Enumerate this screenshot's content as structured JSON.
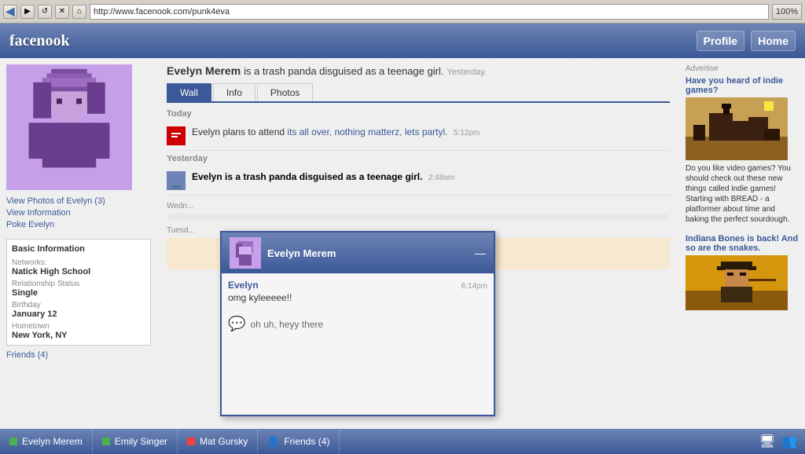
{
  "browser": {
    "back_icon": "◀",
    "forward_icon": "▶",
    "refresh_icon": "↺",
    "stop_icon": "✕",
    "home_icon": "⌂",
    "url": "http://www.facenook.com/punk4eva",
    "zoom": "100%"
  },
  "header": {
    "logo": "facenook",
    "nav": [
      "Profile",
      "Home"
    ]
  },
  "profile": {
    "name": "Evelyn Merem",
    "status": "is a trash panda disguised as a teenage girl.",
    "time": "Yesterday.",
    "tabs": [
      "Wall",
      "Info",
      "Photos"
    ],
    "active_tab": "Wall"
  },
  "sidebar": {
    "links": [
      "View Photos of Evelyn (3)",
      "View Information",
      "Poke Evelyn"
    ],
    "basic_info_title": "Basic Information",
    "networks_label": "Networks:",
    "networks_value": "Natick High School",
    "relationship_label": "Relationship Status",
    "relationship_value": "Single",
    "birthday_label": "Birthday",
    "birthday_value": "January 12",
    "hometown_label": "Hometown",
    "hometown_value": "New York, NY",
    "friends_label": "Friends (4)"
  },
  "wall": {
    "sections": [
      {
        "label": "Today",
        "posts": [
          {
            "icon": "📅",
            "text_start": "Evelyn plans to attend ",
            "text_link": "its all over, nothing matterz, lets partyl.",
            "time": "5:12pm"
          }
        ]
      },
      {
        "label": "Yesterday",
        "posts": [
          {
            "icon": "👤",
            "text_bold": "Evelyn is a trash panda disguised as a teenage girl.",
            "time": "2:48am"
          }
        ]
      }
    ]
  },
  "chat": {
    "name": "Evelyn Merem",
    "close_icon": "—",
    "message": {
      "sender": "Evelyn",
      "time": "6:14pm",
      "text": "omg kyleeeee!!"
    },
    "response_icon": "💬",
    "response_text": "oh uh, heyy there"
  },
  "ads": {
    "label": "Advertise",
    "items": [
      {
        "title": "Have you heard of indie games?",
        "text": "Do you like video games? You should check out these new things called indie games! Starting with BREAD - a platformer about time and baking the perfect sourdough."
      },
      {
        "title": "Indiana Bones is back! And so are the snakes."
      }
    ]
  },
  "taskbar": {
    "items": [
      {
        "name": "Evelyn Merem",
        "status": "green"
      },
      {
        "name": "Emily Singer",
        "status": "green"
      },
      {
        "name": "Mat Gursky",
        "status": "red"
      },
      {
        "name": "Friends (4)",
        "icon": "👤"
      }
    ]
  }
}
